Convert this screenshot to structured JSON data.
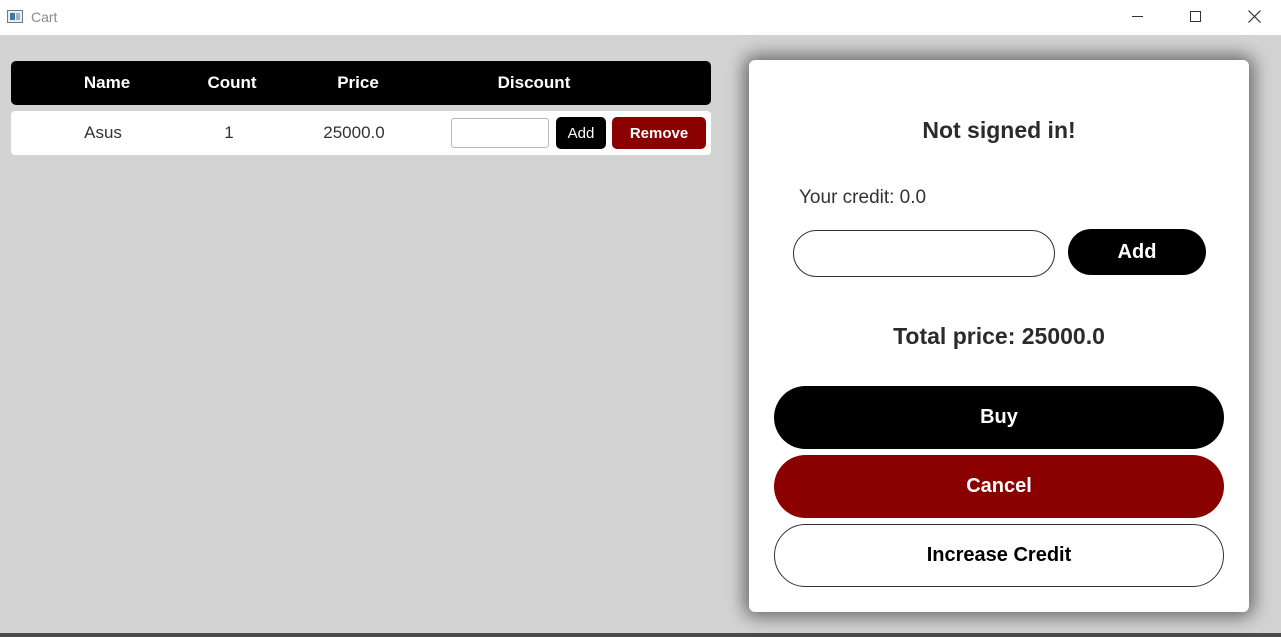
{
  "window": {
    "title": "Cart",
    "icon": "app-window-icon"
  },
  "table": {
    "headers": [
      "Name",
      "Count",
      "Price",
      "Discount"
    ],
    "rows": [
      {
        "name": "Asus",
        "count": "1",
        "price": "25000.0",
        "discount_value": "",
        "add_label": "Add",
        "remove_label": "Remove"
      }
    ]
  },
  "panel": {
    "signin_status": "Not signed in!",
    "credit_label": "Your credit: 0.0",
    "credit_input_value": "",
    "credit_add_label": "Add",
    "total_price": "Total price: 25000.0",
    "buy_label": "Buy",
    "cancel_label": "Cancel",
    "increase_credit_label": "Increase Credit"
  },
  "colors": {
    "background": "#d3d3d3",
    "primary": "#000000",
    "danger": "#8b0000",
    "panel": "#ffffff"
  }
}
